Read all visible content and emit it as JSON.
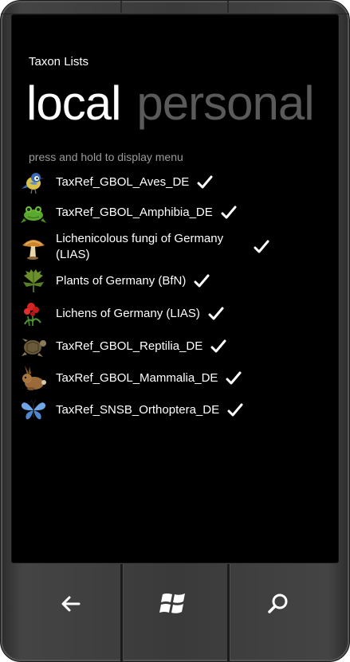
{
  "app": {
    "title": "Taxon Lists"
  },
  "pivot": {
    "active": "local",
    "inactive": "personal"
  },
  "hint": "press and hold to display menu",
  "items": [
    {
      "label": "TaxRef_GBOL_Aves_DE",
      "icon": "bird-icon",
      "checked": true
    },
    {
      "label": "TaxRef_GBOL_Amphibia_DE",
      "icon": "frog-icon",
      "checked": true
    },
    {
      "label": "Lichenicolous fungi of Germany (LIAS)",
      "icon": "mushroom-icon",
      "checked": true
    },
    {
      "label": "Plants of Germany (BfN)",
      "icon": "leaf-icon",
      "checked": true
    },
    {
      "label": "Lichens of Germany (LIAS)",
      "icon": "lichen-icon",
      "checked": true
    },
    {
      "label": "TaxRef_GBOL_Reptilia_DE",
      "icon": "turtle-icon",
      "checked": true
    },
    {
      "label": "TaxRef_GBOL_Mammalia_DE",
      "icon": "rabbit-icon",
      "checked": true
    },
    {
      "label": "TaxRef_SNSB_Orthoptera_DE",
      "icon": "butterfly-icon",
      "checked": true
    }
  ],
  "hardware_buttons": {
    "back": "back-arrow-icon",
    "start": "windows-logo-icon",
    "search": "search-icon"
  }
}
